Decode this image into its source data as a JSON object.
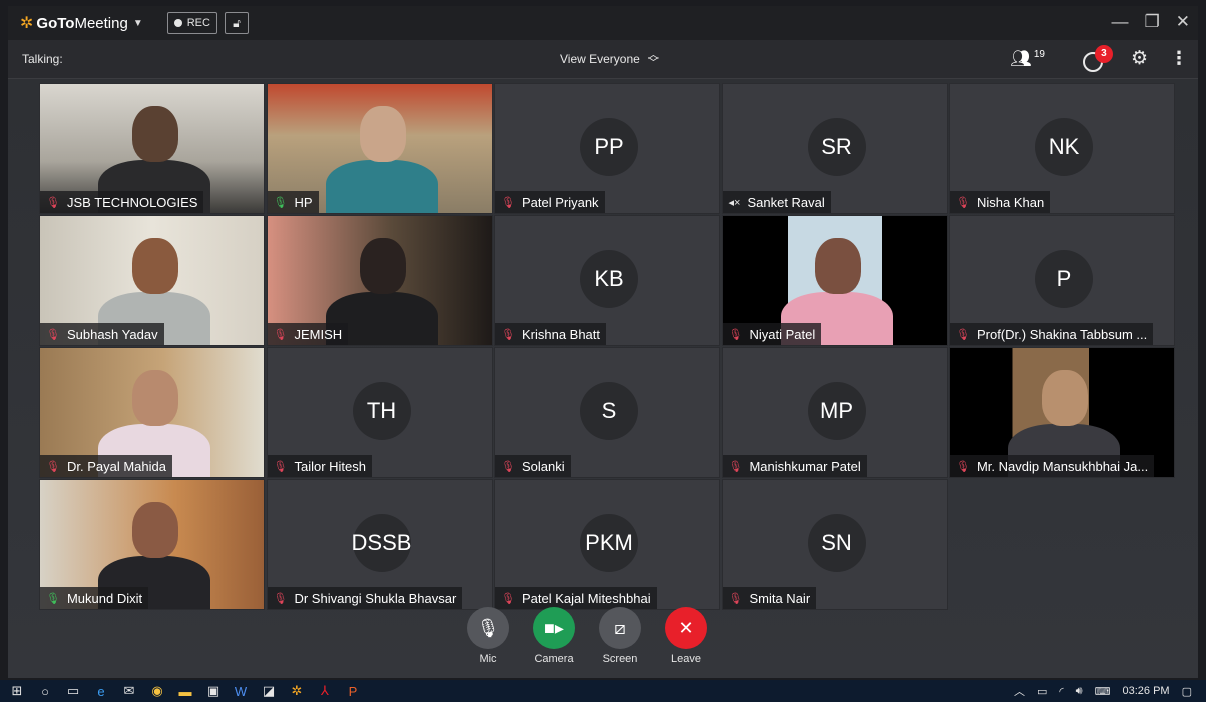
{
  "app": {
    "brand_bold": "GoTo",
    "brand_thin": "Meeting",
    "rec_label": "REC",
    "talking_label": "Talking:",
    "view_label": "View Everyone",
    "attendee_count": "19",
    "chat_badge": "3"
  },
  "participants": [
    {
      "name": "JSB TECHNOLOGIES",
      "initials": "",
      "mic": "muted"
    },
    {
      "name": "HP",
      "initials": "",
      "mic": "on"
    },
    {
      "name": "Patel Priyank",
      "initials": "PP",
      "mic": "muted"
    },
    {
      "name": "Sanket Raval",
      "initials": "SR",
      "mic": "speaker"
    },
    {
      "name": "Nisha Khan",
      "initials": "NK",
      "mic": "muted"
    },
    {
      "name": "Subhash Yadav",
      "initials": "",
      "mic": "muted"
    },
    {
      "name": "JEMISH",
      "initials": "",
      "mic": "muted"
    },
    {
      "name": "Krishna Bhatt",
      "initials": "KB",
      "mic": "muted"
    },
    {
      "name": "Niyati Patel",
      "initials": "",
      "mic": "muted"
    },
    {
      "name": "Prof(Dr.) Shakina Tabbsum ...",
      "initials": "P",
      "mic": "muted"
    },
    {
      "name": "Dr. Payal Mahida",
      "initials": "",
      "mic": "muted"
    },
    {
      "name": "Tailor Hitesh",
      "initials": "TH",
      "mic": "muted"
    },
    {
      "name": "Solanki",
      "initials": "S",
      "mic": "muted"
    },
    {
      "name": "Manishkumar Patel",
      "initials": "MP",
      "mic": "muted"
    },
    {
      "name": "Mr. Navdip Mansukhbhai Ja...",
      "initials": "",
      "mic": "muted"
    },
    {
      "name": "Mukund Dixit",
      "initials": "",
      "mic": "on"
    },
    {
      "name": "Dr Shivangi Shukla Bhavsar",
      "initials": "DSSB",
      "mic": "muted"
    },
    {
      "name": "Patel Kajal Miteshbhai",
      "initials": "PKM",
      "mic": "muted"
    },
    {
      "name": "Smita Nair",
      "initials": "SN",
      "mic": "muted"
    }
  ],
  "controls": {
    "mic_label": "Mic",
    "camera_label": "Camera",
    "screen_label": "Screen",
    "leave_label": "Leave"
  },
  "taskbar": {
    "time": "03:26 PM"
  },
  "colors": {
    "muted_mic": "#e0455a",
    "active_mic": "#3fc05b",
    "camera_green": "#1f9d55",
    "leave_red": "#e8202a",
    "brand_orange": "#f7a823"
  }
}
